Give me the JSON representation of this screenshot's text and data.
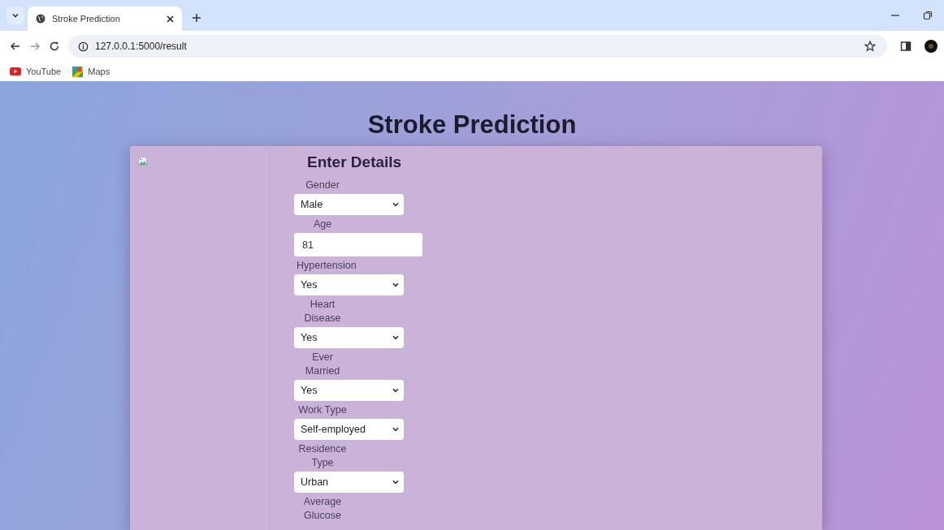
{
  "browser": {
    "tabs": [
      {
        "title": "Stroke Prediction",
        "selected": true
      }
    ],
    "url": "127.0.0.1:5000/result",
    "bookmarks": [
      {
        "label": "YouTube",
        "kind": "youtube"
      },
      {
        "label": "Maps",
        "kind": "maps"
      }
    ]
  },
  "page": {
    "title": "Stroke Prediction",
    "form_title": "Enter Details",
    "fields": [
      {
        "label": "Gender",
        "kind": "select",
        "value": "Male"
      },
      {
        "label": "Age",
        "kind": "input",
        "value": "81"
      },
      {
        "label": "Hypertension",
        "kind": "select",
        "value": "Yes"
      },
      {
        "label": "Heart Disease",
        "kind": "select",
        "value": "Yes"
      },
      {
        "label": "Ever Married",
        "kind": "select",
        "value": "Yes"
      },
      {
        "label": "Work Type",
        "kind": "select",
        "value": "Self-employed"
      },
      {
        "label": "Residence Type",
        "kind": "select",
        "value": "Urban"
      },
      {
        "label": "Average Glucose",
        "kind": "label"
      }
    ]
  }
}
